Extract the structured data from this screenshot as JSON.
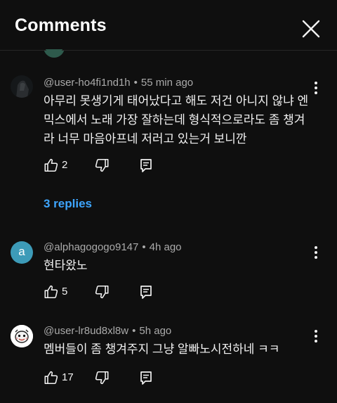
{
  "header": {
    "title": "Comments",
    "close_icon": "close-icon"
  },
  "colors": {
    "background": "#0f0f0f",
    "text": "#f1f1f1",
    "secondary_text": "#aaaaaa",
    "link": "#3ea6ff",
    "avatar_alpha": "#3d9bb8"
  },
  "comments": [
    {
      "author": "@user-ho4fi1nd1h",
      "time": "55 min ago",
      "text": "아무리 못생기게 태어났다고 해도 저건 아니지 않냐 엔믹스에서 노래 가장 잘하는데 형식적으로라도 좀 챙겨라 너무 마음아프네 저러고 있는거 보니깐",
      "likes": "2",
      "replies_label": "3 replies"
    },
    {
      "author": "@alphagogogo9147",
      "time": "4h ago",
      "text": "현타왔노",
      "likes": "5",
      "avatar_letter": "a"
    },
    {
      "author": "@user-lr8ud8xl8w",
      "time": "5h ago",
      "text": "멤버들이 좀 챙겨주지 그냥 알빠노시전하네 ㅋㅋ",
      "likes": "17"
    }
  ],
  "separator": "•"
}
